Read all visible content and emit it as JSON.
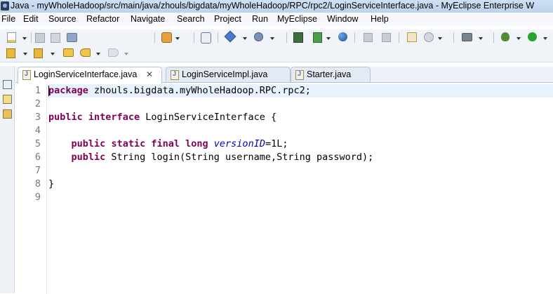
{
  "window": {
    "title": "Java - myWholeHadoop/src/main/java/zhouls/bigdata/myWholeHadoop/RPC/rpc2/LoginServiceInterface.java - MyEclipse Enterprise W"
  },
  "menubar": {
    "items": [
      "File",
      "Edit",
      "Source",
      "Refactor",
      "Navigate",
      "Search",
      "Project",
      "Run",
      "MyEclipse",
      "Window",
      "Help"
    ]
  },
  "toolbar": {
    "icons_row1": [
      "new-wizard-icon",
      "save-icon",
      "save-all-icon",
      "print-icon",
      "open-type-icon",
      "java-badge-icon",
      "new-server-icon",
      "search-icon",
      "deploy-icon",
      "browser-icon",
      "back-icon",
      "forward-icon",
      "web-designer-icon",
      "browser-globe-icon",
      "camera-icon",
      "debug-icon",
      "run-icon"
    ],
    "icons_row2": [
      "next-annotation-icon",
      "prev-edit-location-icon",
      "nav-back-icon",
      "nav-forward-icon"
    ]
  },
  "tabs": [
    {
      "label": "LoginServiceInterface.java",
      "active": true,
      "close": "✕"
    },
    {
      "label": "LoginServiceImpl.java",
      "active": false
    },
    {
      "label": "Starter.java",
      "active": false
    }
  ],
  "editor": {
    "line_numbers": [
      "1",
      "2",
      "3",
      "4",
      "5",
      "6",
      "7",
      "8",
      "9"
    ],
    "line1": {
      "kw": "package",
      "rest": " zhouls.bigdata.myWholeHadoop.RPC.rpc2;"
    },
    "line3": {
      "kw1": "public",
      "kw2": "interface",
      "rest": " LoginServiceInterface {"
    },
    "line5": {
      "indent": "    ",
      "kw1": "public",
      "kw2": "static",
      "kw3": "final",
      "kw4": "long",
      "field": "versionID",
      "rest": "=1L;"
    },
    "line6": {
      "indent": "    ",
      "kw1": "public",
      "rest": " String login(String username,String password);"
    },
    "line8": {
      "text": "}"
    }
  },
  "colors": {
    "keyword": "#7f0055",
    "field": "#0000c0",
    "current_line": "#e8f2fe"
  }
}
